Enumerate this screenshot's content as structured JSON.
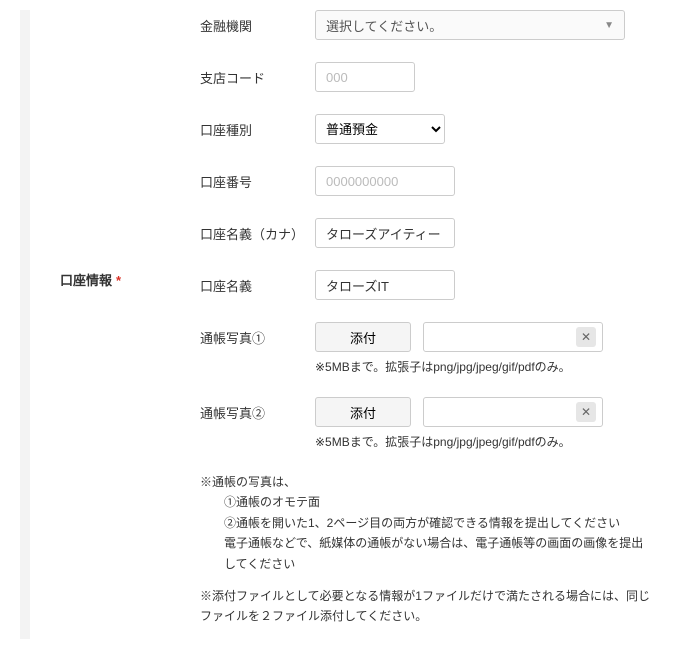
{
  "section": {
    "title": "口座情報",
    "required_mark": "*"
  },
  "fields": {
    "institution": {
      "label": "金融機関",
      "placeholder": "選択してください。"
    },
    "branch_code": {
      "label": "支店コード",
      "placeholder": "000"
    },
    "account_type": {
      "label": "口座種別",
      "value": "普通預金"
    },
    "account_number": {
      "label": "口座番号",
      "placeholder": "0000000000"
    },
    "account_name_kana": {
      "label": "口座名義（カナ）",
      "value": "タローズアイティー"
    },
    "account_name": {
      "label": "口座名義",
      "value": "タローズIT"
    },
    "passbook1": {
      "label": "通帳写真①",
      "attach_label": "添付",
      "hint": "※5MBまで。拡張子はpng/jpg/jpeg/gif/pdfのみ。"
    },
    "passbook2": {
      "label": "通帳写真②",
      "attach_label": "添付",
      "hint": "※5MBまで。拡張子はpng/jpg/jpeg/gif/pdfのみ。"
    }
  },
  "notes": {
    "n1_head": "※通帳の写真は、",
    "n1_line1": "①通帳のオモテ面",
    "n1_line2": "②通帳を開いた1、2ページ目の両方が確認できる情報を提出してください",
    "n1_line3": "電子通帳などで、紙媒体の通帳がない場合は、電子通帳等の画面の画像を提出してください",
    "n2": "※添付ファイルとして必要となる情報が1ファイルだけで満たされる場合には、同じファイルを２ファイル添付してください。"
  }
}
